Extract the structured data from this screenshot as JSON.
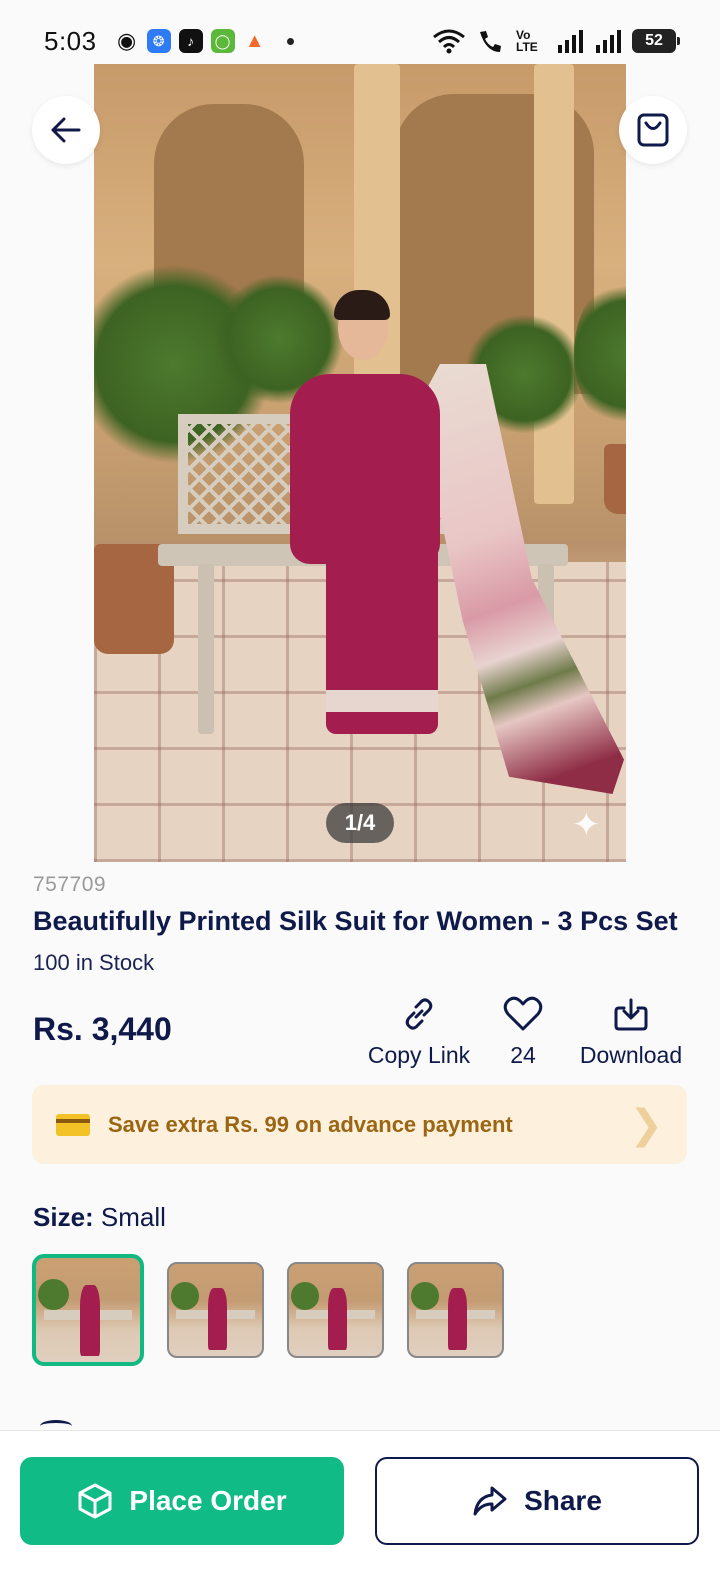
{
  "status_bar": {
    "time": "5:03",
    "battery": "52",
    "icons": [
      "chat-icon",
      "app-blue-icon",
      "tiktok-icon",
      "app-green-icon",
      "app-orange-icon",
      "wifi-icon",
      "call-icon",
      "volte-icon",
      "signal-icon",
      "signal-icon"
    ],
    "volte_label": "Vo LTE"
  },
  "header": {
    "back_icon": "arrow-left-icon",
    "bag_icon": "shopping-bag-icon"
  },
  "gallery": {
    "counter": "1/4",
    "current_index": 1,
    "total": 4
  },
  "product": {
    "sku": "757709",
    "title": "Beautifully Printed Silk Suit for Women - 3 Pcs Set",
    "stock": "100 in Stock",
    "price": "Rs. 3,440"
  },
  "actions": {
    "copy_link": "Copy Link",
    "likes": "24",
    "download": "Download"
  },
  "promo": {
    "text": "Save extra Rs. 99 on advance payment"
  },
  "size": {
    "label": "Size:",
    "value": "Small",
    "selected_thumbnail": 1,
    "thumbnail_count": 4
  },
  "bottom_bar": {
    "place_order": "Place Order",
    "share": "Share"
  },
  "colors": {
    "primary_green": "#10bb85",
    "navy": "#0f1a4a",
    "promo_bg": "#fdf0dc",
    "promo_text": "#9a6614"
  }
}
